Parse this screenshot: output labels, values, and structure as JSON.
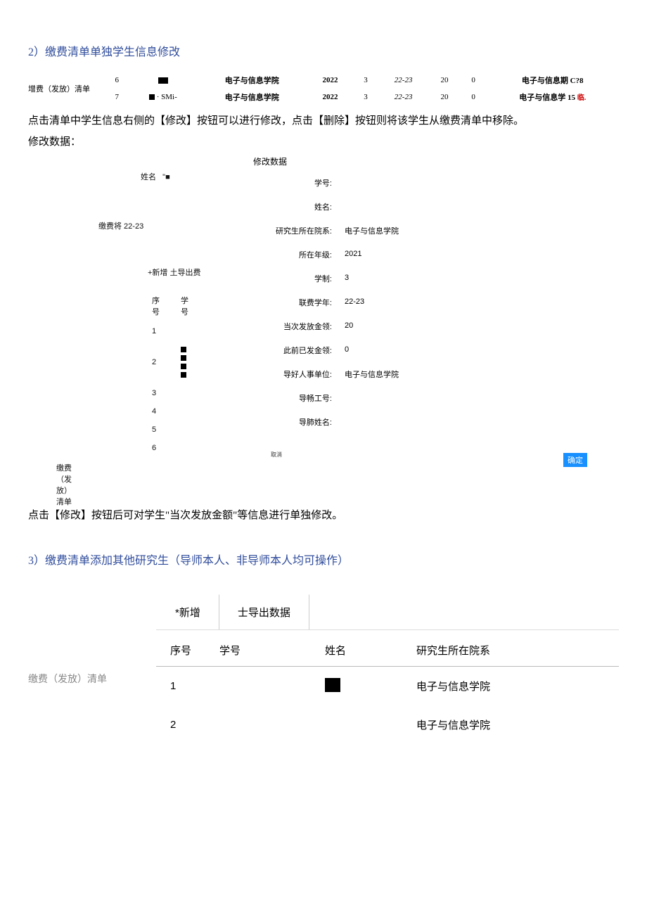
{
  "sections": {
    "s2_heading": "2）缴费清单单独学生信息修改",
    "s3_heading": "3）缴费清单添加其他研究生（导师本人、非导师本人均可操作）"
  },
  "top_side_label": "增费（发放）清单",
  "top_rows": [
    {
      "seq": "6",
      "id": "■■",
      "dept": "电子与信息学院",
      "year": "2022",
      "dur": "3",
      "yr2": "22-23",
      "amt": "20",
      "prev": "0",
      "tail": "电子与信息期 C?8"
    },
    {
      "seq": "7",
      "id": "■・SMi-",
      "dept": "电子与信息学院",
      "year": "2022",
      "dur": "3",
      "yr2": "22-23",
      "amt": "20",
      "prev": "0",
      "tail": "电子与信息学 15",
      "tail_red": "临."
    }
  ],
  "body1": "点击清单中学生信息右侧的【修改】按钮可以进行修改，点击【删除】按钮则将该学生从缴费清单中移除。",
  "body2": "修改数据：",
  "body3": "点击【修改】按钮后可对学生\"当次发放金额\"等信息进行单独修改。",
  "modal": {
    "title": "修改数据",
    "fields": [
      {
        "label": "学号:",
        "value": ""
      },
      {
        "label": "姓名:",
        "value": ""
      },
      {
        "label": "研究生所在院系:",
        "value": "电子与信息学院"
      },
      {
        "label": "所在年级:",
        "value": "2021"
      },
      {
        "label": "学制:",
        "value": "3"
      },
      {
        "label": "联费学年:",
        "value": "22-23"
      },
      {
        "label": "当次发放金领:",
        "value": "20"
      },
      {
        "label": "此前已发金领:",
        "value": "0"
      },
      {
        "label": "导好人事单位:",
        "value": "电子与信息学院"
      },
      {
        "label": "导畅工号:",
        "value": ""
      },
      {
        "label": "导肺姓名:",
        "value": ""
      }
    ],
    "confirm": "确定",
    "cancel_hint": "取消"
  },
  "bg": {
    "name_label": "姓名",
    "name_quote": "\"■",
    "fee_label": "缴费将 22-23",
    "add_export": "+新增  土导出费",
    "hdr_seq": "序号",
    "hdr_id": "学号",
    "rows": [
      "1",
      "2",
      "3",
      "4",
      "5",
      "6"
    ],
    "row2_id": "■■■ ■",
    "side2": "缴费（发放）清单"
  },
  "add": {
    "side": "缴费（发放）清单",
    "tab1": "*新增",
    "tab2": "士导出数据",
    "hdr_seq": "序号",
    "hdr_id": "学号",
    "hdr_name": "姓名",
    "hdr_dept": "研究生所在院系",
    "rows": [
      {
        "seq": "1",
        "id": "",
        "name_redacted": true,
        "dept": "电子与信息学院"
      },
      {
        "seq": "2",
        "id": "",
        "name_redacted": false,
        "dept": "电子与信息学院"
      }
    ]
  }
}
